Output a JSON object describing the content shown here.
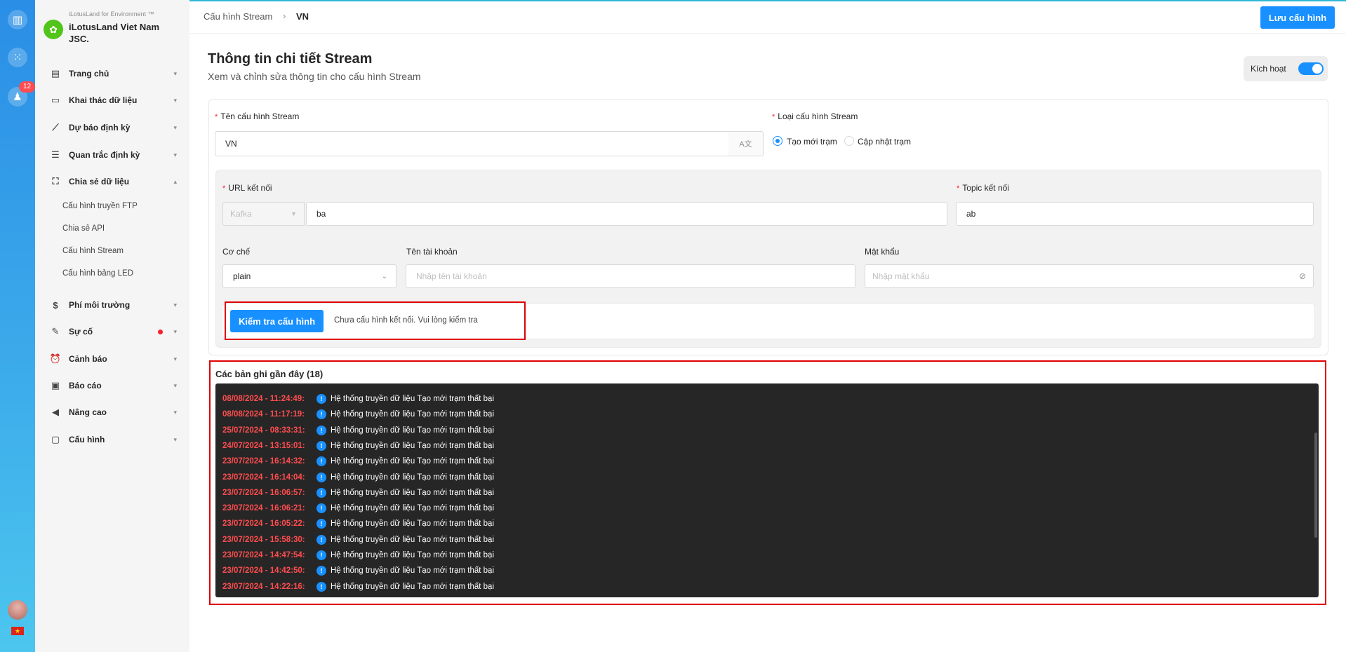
{
  "rail": {
    "icons": [
      "app-logo-icon",
      "grid-icon",
      "bell-icon"
    ],
    "notification_count": "12",
    "flag": "★"
  },
  "sidebar": {
    "org_small": "iLotusLand for Environment ™",
    "org_name": "iLotusLand Viet Nam JSC.",
    "items": [
      {
        "label": "Trang chủ",
        "icon": "layout-icon"
      },
      {
        "label": "Khai thác dữ liệu",
        "icon": "monitor-icon"
      },
      {
        "label": "Dự báo định kỳ",
        "icon": "chart-line-icon"
      },
      {
        "label": "Quan trắc định kỳ",
        "icon": "document-icon"
      },
      {
        "label": "Chia sẻ dữ liệu",
        "icon": "share-icon"
      },
      {
        "label": "Phí môi trường",
        "icon": "dollar-icon"
      },
      {
        "label": "Sự cố",
        "icon": "edit-icon"
      },
      {
        "label": "Cảnh báo",
        "icon": "alarm-icon"
      },
      {
        "label": "Báo cáo",
        "icon": "report-icon"
      },
      {
        "label": "Nâng cao",
        "icon": "megaphone-icon"
      },
      {
        "label": "Cấu hình",
        "icon": "settings-icon"
      }
    ],
    "sub_items": [
      "Cấu hình truyền FTP",
      "Chia sẻ API",
      "Cấu hình Stream",
      "Cấu hình bảng LED"
    ]
  },
  "header": {
    "breadcrumb_parent": "Cấu hình Stream",
    "breadcrumb_sep": "›",
    "breadcrumb_current": "VN",
    "save_label": "Lưu cấu hình"
  },
  "main": {
    "title": "Thông tin chi tiết Stream",
    "subtitle": "Xem và chỉnh sửa thông tin cho cấu hình Stream",
    "activate_label": "Kích hoạt",
    "activate_on": true
  },
  "form": {
    "name_label": "Tên cấu hình Stream",
    "name_value": "VN",
    "type_label": "Loại cấu hình Stream",
    "type_options": [
      "Tạo mới trạm",
      "Cập nhật trạm"
    ],
    "type_selected": "Tạo mới trạm",
    "url_label": "URL kết nối",
    "url_protocol": "Kafka",
    "url_value": "ba",
    "topic_label": "Topic kết nối",
    "topic_value": "ab",
    "mechanism_label": "Cơ chế",
    "mechanism_value": "plain",
    "username_label": "Tên tài khoản",
    "username_placeholder": "Nhập tên tài khoản",
    "password_label": "Mật khẩu",
    "password_placeholder": "Nhập mật khẩu",
    "test_button": "Kiểm tra cấu hình",
    "test_message": "Chưa cấu hình kết nối. Vui lòng kiểm tra"
  },
  "logs": {
    "title": "Các bản ghi gần đây (18)",
    "entries": [
      {
        "ts": "08/08/2024 - 11:24:49:",
        "msg": "Hệ thống truyền dữ liệu Tạo mới trạm thất bại"
      },
      {
        "ts": "08/08/2024 - 11:17:19:",
        "msg": "Hệ thống truyền dữ liệu Tạo mới trạm thất bại"
      },
      {
        "ts": "25/07/2024 - 08:33:31:",
        "msg": "Hệ thống truyền dữ liệu Tạo mới trạm thất bại"
      },
      {
        "ts": "24/07/2024 - 13:15:01:",
        "msg": "Hệ thống truyền dữ liệu Tạo mới trạm thất bại"
      },
      {
        "ts": "23/07/2024 - 16:14:32:",
        "msg": "Hệ thống truyền dữ liệu Tạo mới trạm thất bại"
      },
      {
        "ts": "23/07/2024 - 16:14:04:",
        "msg": "Hệ thống truyền dữ liệu Tạo mới trạm thất bại"
      },
      {
        "ts": "23/07/2024 - 16:06:57:",
        "msg": "Hệ thống truyền dữ liệu Tạo mới trạm thất bại"
      },
      {
        "ts": "23/07/2024 - 16:06:21:",
        "msg": "Hệ thống truyền dữ liệu Tạo mới trạm thất bại"
      },
      {
        "ts": "23/07/2024 - 16:05:22:",
        "msg": "Hệ thống truyền dữ liệu Tạo mới trạm thất bại"
      },
      {
        "ts": "23/07/2024 - 15:58:30:",
        "msg": "Hệ thống truyền dữ liệu Tạo mới trạm thất bại"
      },
      {
        "ts": "23/07/2024 - 14:47:54:",
        "msg": "Hệ thống truyền dữ liệu Tạo mới trạm thất bại"
      },
      {
        "ts": "23/07/2024 - 14:42:50:",
        "msg": "Hệ thống truyền dữ liệu Tạo mới trạm thất bại"
      },
      {
        "ts": "23/07/2024 - 14:22:16:",
        "msg": "Hệ thống truyền dữ liệu Tạo mới trạm thất bại"
      }
    ]
  },
  "colors": {
    "primary": "#1890ff",
    "error": "#ff4d4f",
    "log_bg": "#262626",
    "highlight_frame": "#e00000"
  }
}
